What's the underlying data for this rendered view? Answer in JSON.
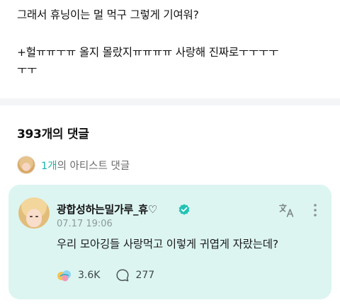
{
  "post": {
    "line1": "그래서 휴닝이는 멀 먹구 그렇게 기여워?",
    "line2": "+헐ㅠㅠㅜㅠ 올지 몰랐지ㅠㅠㅠㅠ  사랑해 진짜로ㅜㅜㅜㅜ",
    "line3": "ㅜㅜ"
  },
  "comments": {
    "title": "393개의 댓글",
    "artist_count": "1개",
    "artist_label": "의 아티스트 댓글"
  },
  "artist_comment": {
    "author": "광합성하는밀가루_휴♡",
    "timestamp": "07.17 19:06",
    "text": "우리 모아깅들 사랑먹고 이렇게 귀엽게 자랐는데?",
    "likes": "3.6K",
    "replies": "277",
    "background_color": "#dcf5f1",
    "verified_color": "#22c3b4",
    "icons": {
      "verified": "verified-badge-icon",
      "translate": "translate-icon",
      "more": "more-vertical-icon",
      "like": "like-reaction-icon",
      "reply": "reply-bubble-icon"
    }
  }
}
